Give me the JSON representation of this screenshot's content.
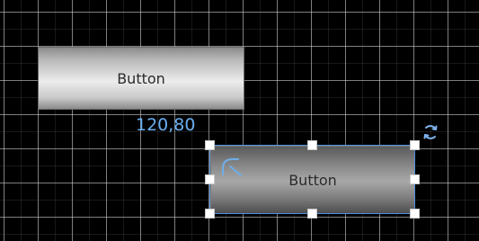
{
  "canvas": {
    "grid_color": "#d2d2d2",
    "background": "#000000"
  },
  "controls": [
    {
      "label": "Button",
      "state": "unselected"
    },
    {
      "label": "Button",
      "state": "selected"
    }
  ],
  "position_readout": "120,80",
  "icons": {
    "rotate": "rotate-icon",
    "corner_radius": "corner-radius-icon"
  },
  "colors": {
    "selection": "#4e8fdb",
    "readout_text": "#69aef0",
    "handle": "#ffffff"
  }
}
